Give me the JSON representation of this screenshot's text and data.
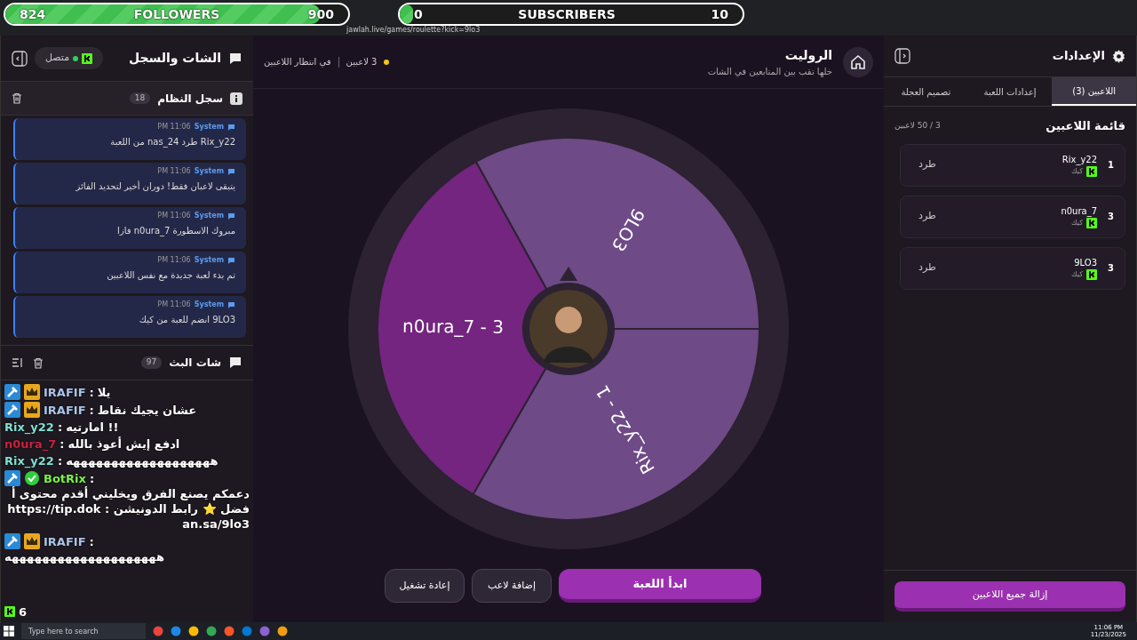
{
  "stream_overlay": {
    "followers_goal": {
      "label": "FOLLOWERS",
      "current": "824",
      "target": "900",
      "level": 0.92
    },
    "subscribers_goal": {
      "label": "SUBSCRIBERS",
      "current": "0",
      "target": "10",
      "level": 0.04
    }
  },
  "browser": {
    "url": "jawlah.live/games/roulette?kick=9lo3"
  },
  "chat_panel": {
    "title": "الشات والسجل",
    "connection": {
      "label": "متصل",
      "connected": true
    },
    "system_log": {
      "title": "سجل النظام",
      "count": "18",
      "entries": [
        {
          "sender": "System",
          "time": "11:06 PM",
          "text": "Rix_y22 طرد nas_24 من اللعبة"
        },
        {
          "sender": "System",
          "time": "11:06 PM",
          "text": "يتبقى لاعبان فقط! دوران أخير لتحديد الفائز"
        },
        {
          "sender": "System",
          "time": "11:06 PM",
          "text": "مبروك الاسطورة n0ura_7 فازا"
        },
        {
          "sender": "System",
          "time": "11:06 PM",
          "text": "تم بدء لعبة جديدة مع نفس اللاعبين"
        },
        {
          "sender": "System",
          "time": "11:06 PM",
          "text": "9LO3 انضم للعبة من كيك"
        }
      ]
    },
    "stream_chat": {
      "title": "شات البث",
      "count": "97"
    }
  },
  "overlay_chat": [
    {
      "user": "IRAFIF",
      "color": "#a9c4e8",
      "mod_badge": true,
      "vip_badge": true,
      "verified_badge": false,
      "separator": ":",
      "message": "يلا"
    },
    {
      "user": "IRAFIF",
      "color": "#a9c4e8",
      "mod_badge": true,
      "vip_badge": true,
      "verified_badge": false,
      "separator": ":",
      "message": "عشان يجيك نقاط"
    },
    {
      "user": "Rix_y22",
      "color": "#7fe0d0",
      "mod_badge": false,
      "vip_badge": false,
      "verified_badge": false,
      "separator": ":",
      "message": "!! امارتيه"
    },
    {
      "user": "n0ura_7",
      "color": "#c8223f",
      "mod_badge": false,
      "vip_badge": false,
      "verified_badge": false,
      "separator": ":",
      "message": "ادفع إيش أعوذ بالله"
    },
    {
      "user": "Rix_y22",
      "color": "#7fe0d0",
      "mod_badge": false,
      "vip_badge": false,
      "verified_badge": false,
      "separator": ":",
      "message": "هههههههههههههههههههه"
    },
    {
      "user": "BotRix",
      "color": "#7cf04a",
      "mod_badge": true,
      "vip_badge": false,
      "verified_badge": true,
      "separator": ":",
      "message": "دعمكم يصنع الفرق ويخليني أقدم محتوى أفضل ⭐ رابط الدونيشن : https://tip.dokan.sa/9lo3"
    },
    {
      "user": "IRAFIF",
      "color": "#a9c4e8",
      "mod_badge": true,
      "vip_badge": true,
      "verified_badge": false,
      "separator": ":",
      "message": "ههههههههههههههههههههه"
    }
  ],
  "viewer_count": "6",
  "game": {
    "title": "الروليت",
    "subtitle": "خلها تقب بين المتابعين في الشات",
    "players_status": "3 لاعبين",
    "state": "في انتظار اللاعبين",
    "wheel": {
      "segments": [
        {
          "label": "9LO3",
          "color": "#6e4a86"
        },
        {
          "label": "Rix_y22 - 1",
          "color": "#6e4a86"
        },
        {
          "label": "n0ura_7 - 3",
          "color": "#74257f"
        }
      ]
    },
    "buttons": [
      {
        "label": "ابدأ اللعبة",
        "kind": "primary"
      },
      {
        "label": "إضافة لاعب",
        "kind": "secondary"
      },
      {
        "label": "إعادة تشغيل",
        "kind": "secondary"
      }
    ]
  },
  "settings": {
    "title": "الإعدادات",
    "tabs": [
      {
        "label": "اللاعبين (3)",
        "selected": true
      },
      {
        "label": "إعدادات اللعبة",
        "selected": false
      },
      {
        "label": "تصميم العجلة",
        "selected": false
      }
    ],
    "list_title": "قائمة اللاعبين",
    "list_count": "3 / 50 لاعبين",
    "players": [
      {
        "rank": "1",
        "name": "Rix_y22",
        "platform": "كيك",
        "action": "طرد"
      },
      {
        "rank": "3",
        "name": "n0ura_7",
        "platform": "كيك",
        "action": "طرد"
      },
      {
        "rank": "3",
        "name": "9LO3",
        "platform": "كيك",
        "action": "طرد"
      }
    ],
    "clear_button": "إزالة جميع اللاعبين"
  },
  "taskbar": {
    "search_placeholder": "Type here to search",
    "time": "11:06 PM",
    "date": "11/23/2025"
  }
}
